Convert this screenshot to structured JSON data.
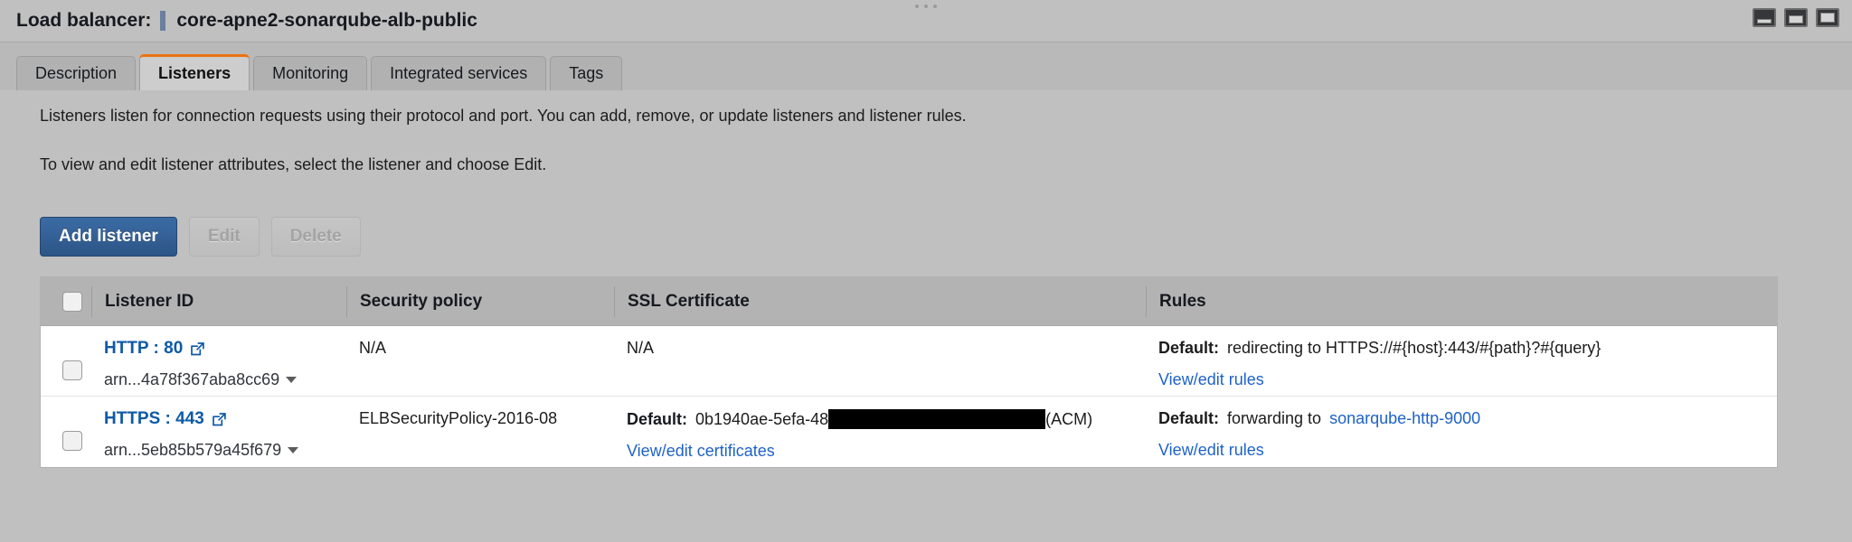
{
  "window": {
    "title_label": "Load balancer:",
    "resource_name": "core-apne2-sonarqube-alb-public",
    "buttons": [
      {
        "name": "minimize-window-button",
        "icon": "minimize-icon"
      },
      {
        "name": "restore-window-button",
        "icon": "restore-icon"
      },
      {
        "name": "maximize-window-button",
        "icon": "maximize-icon"
      }
    ],
    "accent_color": "#ec7211"
  },
  "tabs": [
    {
      "label": "Description",
      "active": false
    },
    {
      "label": "Listeners",
      "active": true
    },
    {
      "label": "Monitoring",
      "active": false
    },
    {
      "label": "Integrated services",
      "active": false
    },
    {
      "label": "Tags",
      "active": false
    }
  ],
  "content": {
    "intro_text": "Listeners listen for connection requests using their protocol and port. You can add, remove, or update listeners and listener rules.",
    "helper_text": "To view and edit listener attributes, select the listener and choose Edit."
  },
  "toolbar": {
    "add_listener_label": "Add listener",
    "edit_label": "Edit",
    "delete_label": "Delete"
  },
  "table": {
    "columns": [
      "Listener ID",
      "Security policy",
      "SSL Certificate",
      "Rules"
    ],
    "rows": [
      {
        "listener": "HTTP : 80",
        "arn": "arn...4a78f367aba8cc69",
        "security_policy": "N/A",
        "ssl_certificate": "N/A",
        "ssl_has_default": false,
        "ssl_default_label": "",
        "ssl_certificate_id": "",
        "ssl_certificate_suffix": "",
        "ssl_link": "",
        "rule_default_label": "Default:",
        "rule_action": "redirecting to HTTPS://#{host}:443/#{path}?#{query}",
        "rule_target": "",
        "rules_link": "View/edit rules"
      },
      {
        "listener": "HTTPS : 443",
        "arn": "arn...5eb85b579a45f679",
        "security_policy": "ELBSecurityPolicy-2016-08",
        "ssl_certificate": "",
        "ssl_has_default": true,
        "ssl_default_label": "Default:",
        "ssl_certificate_id": "0b1940ae-5efa-48",
        "ssl_certificate_suffix": "(ACM)",
        "ssl_link": "View/edit certificates",
        "rule_default_label": "Default:",
        "rule_action": "forwarding to",
        "rule_target": "sonarqube-http-9000",
        "rules_link": "View/edit rules"
      }
    ]
  },
  "colors": {
    "primary_button": "#2d5586",
    "link": "#1e62c7",
    "listener_link": "#0d5aa7",
    "tab_accent": "#ec7211",
    "redaction": "#000000"
  }
}
